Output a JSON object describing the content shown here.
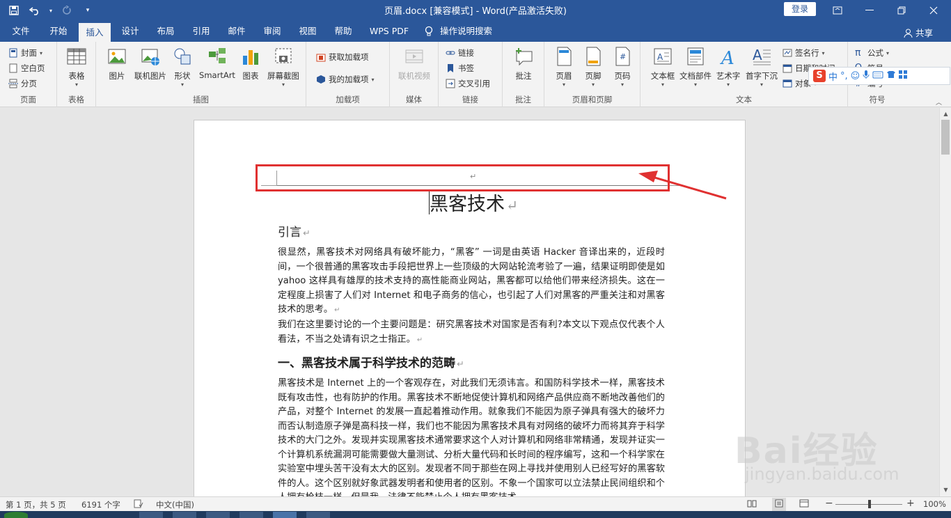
{
  "window": {
    "title": "页眉.docx [兼容模式]  -  Word(产品激活失败)",
    "login_label": "登录"
  },
  "qat": {
    "save_icon": "save-icon",
    "undo_icon": "undo-icon",
    "redo_icon": "redo-icon",
    "customize_icon": "customize-qat-icon"
  },
  "tabs": [
    "文件",
    "开始",
    "插入",
    "设计",
    "布局",
    "引用",
    "邮件",
    "审阅",
    "视图",
    "帮助",
    "WPS PDF"
  ],
  "active_tab": "插入",
  "tell_me": "操作说明搜索",
  "share": "共享",
  "ribbon": {
    "pages": {
      "label": "页面",
      "cover": "封面",
      "blank": "空白页",
      "break": "分页"
    },
    "tables": {
      "label": "表格",
      "table": "表格"
    },
    "illustrations": {
      "label": "插图",
      "picture": "图片",
      "online_picture": "联机图片",
      "shapes": "形状",
      "smartart": "SmartArt",
      "chart": "图表",
      "screenshot": "屏幕截图"
    },
    "addins": {
      "label": "加载项",
      "get": "获取加载项",
      "my": "我的加载项"
    },
    "media": {
      "label": "媒体",
      "online_video": "联机视频"
    },
    "links": {
      "label": "链接",
      "link": "链接",
      "bookmark": "书签",
      "cross_ref": "交叉引用"
    },
    "comments": {
      "label": "批注",
      "comment": "批注"
    },
    "header_footer": {
      "label": "页眉和页脚",
      "header": "页眉",
      "footer": "页脚",
      "page_number": "页码"
    },
    "text": {
      "label": "文本",
      "textbox": "文本框",
      "quick_parts": "文档部件",
      "wordart": "艺术字",
      "dropcap": "首字下沉",
      "signature": "签名行",
      "datetime": "日期和时间",
      "object": "对象"
    },
    "symbols": {
      "label": "符号",
      "equation": "公式",
      "symbol": "符号",
      "number": "编号"
    }
  },
  "ime": {
    "lang": "中",
    "punct": "°,"
  },
  "document": {
    "header_mark": "↵",
    "title": "黑客技术",
    "para_mark": "↵",
    "intro_heading": "引言",
    "intro_p1": "很显然，黑客技术对网络具有破坏能力，“黑客” 一词是由英语 Hacker 音译出来的，近段时间，一个很普通的黑客攻击手段把世界上一些顶级的大网站轮流考验了一遍，结果证明即使是如 yahoo 这样具有雄厚的技术支持的高性能商业网站，黑客都可以给他们带来经济损失。这在一定程度上损害了人们对 Internet 和电子商务的信心，也引起了人们对黑客的严重关注和对黑客技术的思考。",
    "intro_p2": "我们在这里要讨论的一个主要问题是：研究黑客技术对国家是否有利?本文以下观点仅代表个人看法，不当之处请有识之士指正。",
    "sec1_heading": "一、黑客技术属于科学技术的范畴",
    "sec1_p1": "黑客技术是 Internet 上的一个客观存在，对此我们无须讳言。和国防科学技术一样，黑客技术既有攻击性，也有防护的作用。黑客技术不断地促使计算机和网络产品供应商不断地改善他们的产品，对整个 Internet 的发展一直起着推动作用。就象我们不能因为原子弹具有强大的破坏力而否认制造原子弹是高科技一样，我们也不能因为黑客技术具有对网络的破坏力而将其弃于科学技术的大门之外。发现并实现黑客技术通常要求这个人对计算机和网络非常精通，发现并证实一个计算机系统漏洞可能需要做大量测试、分析大量代码和长时间的程序编写，这和一个科学家在实验室中埋头苦干没有太大的区别。发现者不同于那些在网上寻找并使用别人已经写好的黑客软件的人。这个区别就好象武器发明者和使用者的区别。不象一个国家可以立法禁止民间组织和个人拥有枪枝一样，但是我，法律不能禁止个人拥有黑客技术。"
  },
  "status": {
    "page": "第 1 页，共 5 页",
    "words": "6191 个字",
    "language": "中文(中国)",
    "zoom": "100%",
    "zoom_value": 100
  },
  "watermark": {
    "brand": "Bai经验",
    "url": "jingyan.baidu.com"
  },
  "colors": {
    "accent": "#2b579a",
    "annotation": "#e03131"
  }
}
